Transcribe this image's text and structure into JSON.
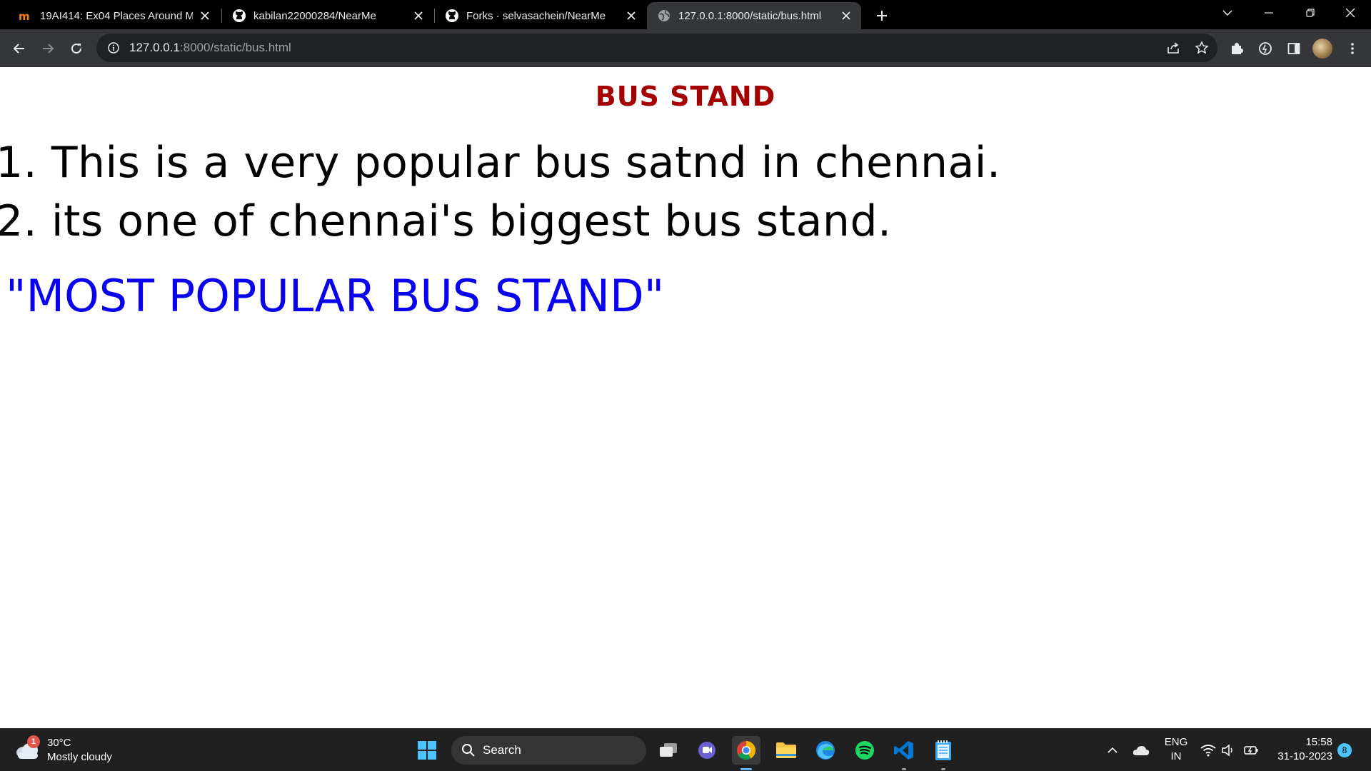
{
  "browser": {
    "tabs": [
      {
        "title": "19AI414: Ex04 Places Around Me",
        "favicon": "moodle-icon",
        "active": false
      },
      {
        "title": "kabilan22000284/NearMe",
        "favicon": "github-icon",
        "active": false
      },
      {
        "title": "Forks · selvasachein/NearMe",
        "favicon": "github-icon",
        "active": false
      },
      {
        "title": "127.0.0.1:8000/static/bus.html",
        "favicon": "globe-icon",
        "active": true
      }
    ],
    "url_host": "127.0.0.1",
    "url_path": ":8000/static/bus.html"
  },
  "page": {
    "heading": "BUS STAND",
    "items": [
      "1. This is a very popular bus satnd in chennai.",
      "2. its one of chennai's biggest bus stand."
    ],
    "quote": "\"MOST POPULAR BUS STAND\"",
    "colors": {
      "heading": "#a40000",
      "quote": "#0a00f0",
      "text": "#000000"
    }
  },
  "taskbar": {
    "weather": {
      "badge": "1",
      "temp": "30°C",
      "condition": "Mostly cloudy"
    },
    "search_label": "Search",
    "language": {
      "lang": "ENG",
      "region": "IN"
    },
    "clock": {
      "time": "15:58",
      "date": "31-10-2023"
    },
    "notification_count": "8"
  }
}
